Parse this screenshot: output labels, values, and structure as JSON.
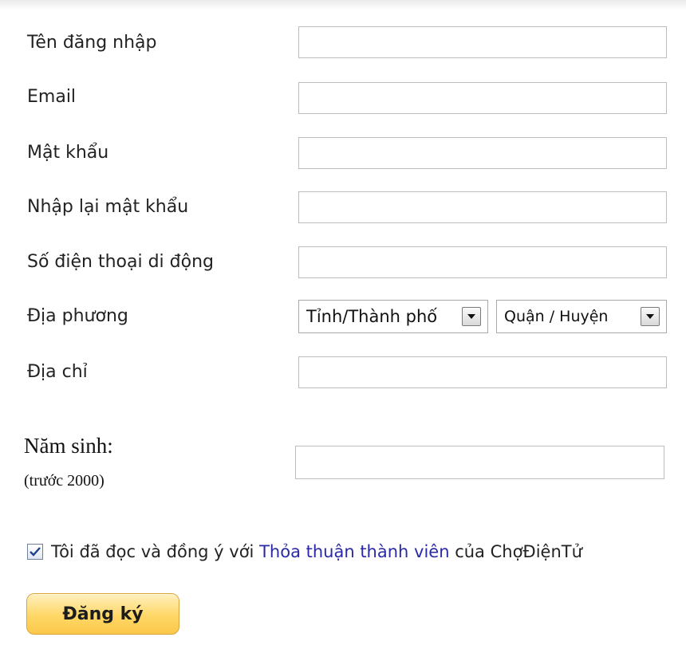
{
  "form": {
    "username": {
      "label": "Tên đăng nhập",
      "value": ""
    },
    "email": {
      "label": "Email",
      "value": ""
    },
    "password": {
      "label": "Mật khẩu",
      "value": ""
    },
    "password_confirm": {
      "label": "Nhập lại mật khẩu",
      "value": ""
    },
    "phone": {
      "label": "Số điện thoại di động",
      "value": ""
    },
    "location": {
      "label": "Địa phương",
      "province_selected": "Tỉnh/Thành phố",
      "district_selected": "Quận / Huyện"
    },
    "address": {
      "label": "Địa chỉ",
      "value": ""
    },
    "birth_year": {
      "label": "Năm sinh:",
      "hint": "(trước 2000)",
      "value": ""
    },
    "agreement": {
      "checked": true,
      "text_before": "Tôi đã đọc và đồng ý với",
      "link_text": "Thỏa thuận thành viên",
      "text_after": "của ChợĐiệnTử"
    },
    "submit_label": "Đăng ký"
  },
  "colors": {
    "link": "#2a2aa8",
    "button_top": "#fff0bf",
    "button_bottom": "#fbc84a",
    "input_border": "#bdbdbd"
  }
}
